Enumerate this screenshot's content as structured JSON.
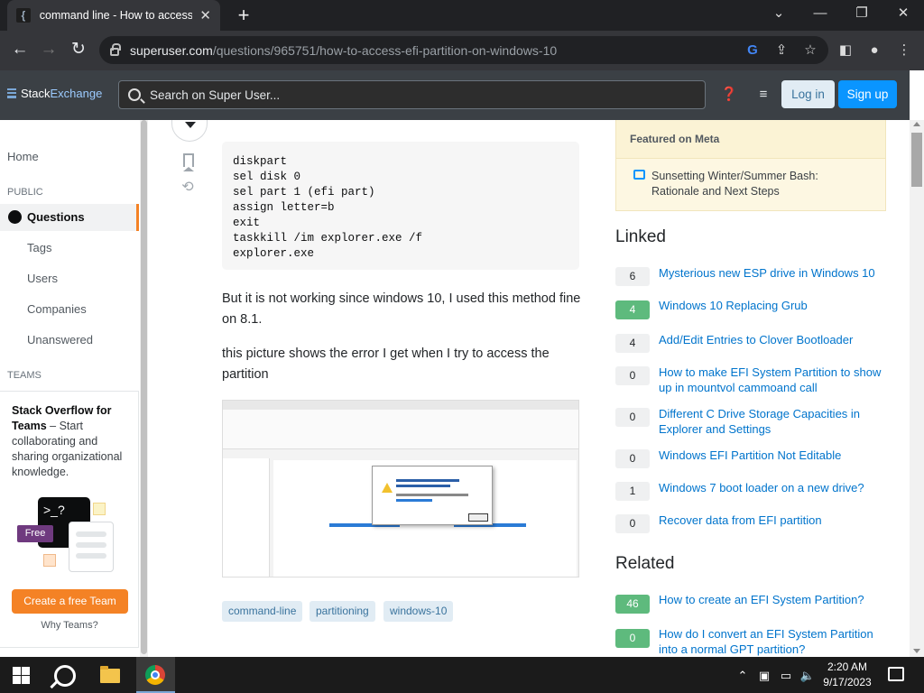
{
  "browser": {
    "tab_title": "command line - How to access efi",
    "tab_favicon": "{",
    "url_domain": "superuser.com",
    "url_path": "/questions/965751/how-to-access-efi-partition-on-windows-10"
  },
  "header": {
    "logo_stack": "Stack",
    "logo_exchange": "Exchange",
    "search_placeholder": "Search on Super User...",
    "login": "Log in",
    "signup": "Sign up"
  },
  "leftnav": {
    "home": "Home",
    "public": "PUBLIC",
    "questions": "Questions",
    "tags": "Tags",
    "users": "Users",
    "companies": "Companies",
    "unanswered": "Unanswered",
    "teams": "TEAMS",
    "teams_title": "Stack Overflow for Teams",
    "teams_text": " – Start collaborating and sharing organizational knowledge.",
    "free": "Free",
    "create_team": "Create a free Team",
    "why_teams": "Why Teams?",
    "illo_prompt": ">_?"
  },
  "post": {
    "code": "diskpart\nsel disk 0\nsel part 1 (efi part)\nassign letter=b\nexit\ntaskkill /im explorer.exe /f\nexplorer.exe",
    "para1": "But it is not working since windows 10, I used this method fine on 8.1.",
    "para2": "this picture shows the error I get when I try to access the partition",
    "tags": [
      "command-line",
      "partitioning",
      "windows-10"
    ]
  },
  "sidebar": {
    "meta_header": "Featured on Meta",
    "meta_link": "Sunsetting Winter/Summer Bash: Rationale and Next Steps",
    "linked_title": "Linked",
    "linked": [
      {
        "count": "6",
        "title": "Mysterious new ESP drive in Windows 10",
        "accepted": false
      },
      {
        "count": "4",
        "title": "Windows 10 Replacing Grub",
        "accepted": true
      },
      {
        "count": "4",
        "title": "Add/Edit Entries to Clover Bootloader",
        "accepted": false
      },
      {
        "count": "0",
        "title": "How to make EFI System Partition to show up in mountvol cammoand call",
        "accepted": false
      },
      {
        "count": "0",
        "title": "Different C Drive Storage Capacities in Explorer and Settings",
        "accepted": false
      },
      {
        "count": "0",
        "title": "Windows EFI Partition Not Editable",
        "accepted": false
      },
      {
        "count": "1",
        "title": "Windows 7 boot loader on a new drive?",
        "accepted": false
      },
      {
        "count": "0",
        "title": "Recover data from EFI partition",
        "accepted": false
      }
    ],
    "related_title": "Related",
    "related": [
      {
        "count": "46",
        "title": "How to create an EFI System Partition?",
        "accepted": true
      },
      {
        "count": "0",
        "title": "How do I convert an EFI System Partition into a normal GPT partition?",
        "accepted": true
      }
    ]
  },
  "taskbar": {
    "time": "2:20 AM",
    "date": "9/17/2023"
  }
}
